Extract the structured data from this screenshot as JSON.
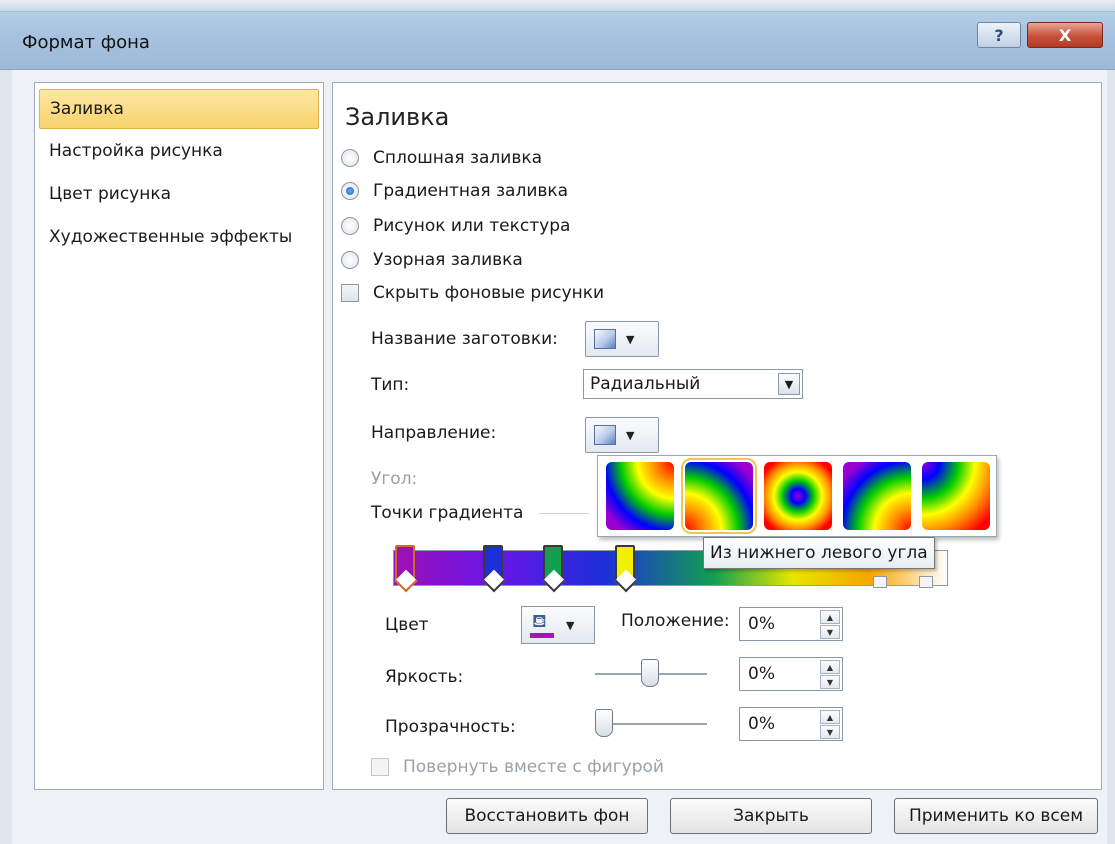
{
  "window": {
    "title": "Формат фона",
    "help_glyph": "?",
    "close_glyph": "X"
  },
  "nav": {
    "items": [
      {
        "label": "Заливка",
        "active": true
      },
      {
        "label": "Настройка рисунка"
      },
      {
        "label": "Цвет рисунка"
      },
      {
        "label": "Художественные эффекты"
      }
    ]
  },
  "fill": {
    "title": "Заливка",
    "options": [
      {
        "label": "Сплошная заливка",
        "checked": false
      },
      {
        "label": "Градиентная заливка",
        "checked": true
      },
      {
        "label": "Рисунок или текстура",
        "checked": false
      },
      {
        "label": "Узорная заливка",
        "checked": false
      }
    ],
    "hide_background": {
      "label": "Скрыть фоновые рисунки",
      "checked": false
    },
    "preset_label": "Название заготовки:",
    "type_label": "Тип:",
    "type_value": "Радиальный",
    "direction_label": "Направление:",
    "angle_label": "Угол:",
    "stops_label": "Точки градиента",
    "tooltip": "Из нижнего левого угла",
    "color_label": "Цвет",
    "position_label": "Положение:",
    "position_value": "0%",
    "brightness_label": "Яркость:",
    "brightness_value": "0%",
    "transparency_label": "Прозрачность:",
    "transparency_value": "0%",
    "rotate_label": "Повернуть вместе с фигурой",
    "gradient_stops": [
      {
        "color": "#9b11b8",
        "selected": true
      },
      {
        "color": "#1d2fd8"
      },
      {
        "color": "#12a050"
      },
      {
        "color": "#f0f000"
      }
    ]
  },
  "buttons": {
    "reset": "Восстановить фон",
    "close": "Закрыть",
    "apply_all": "Применить ко всем"
  },
  "colors": {
    "accent": "#f8d26b",
    "selected_stop": "#d06a28",
    "color_line": "#a514b8"
  }
}
